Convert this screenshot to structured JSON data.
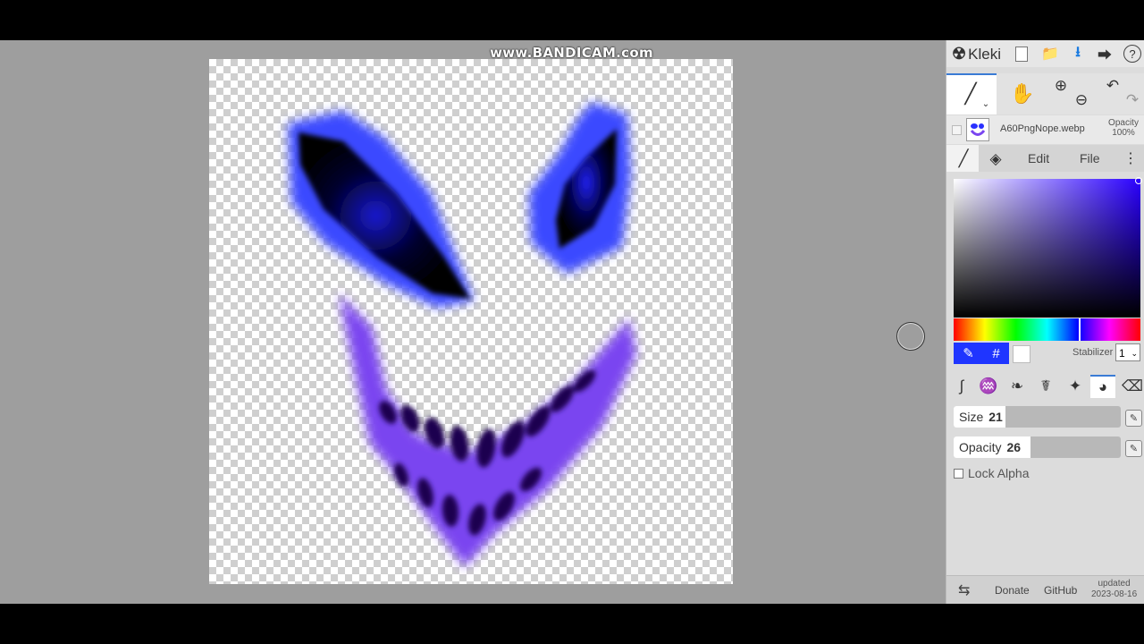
{
  "recording": {
    "watermark": "www.BANDICAM.com"
  },
  "app": {
    "name": "Kleki",
    "header_icons": [
      "new-file-icon",
      "open-folder-icon",
      "download-icon",
      "share-icon",
      "help-icon"
    ],
    "help_glyph": "?"
  },
  "toolbar": {
    "tools": [
      "brush-tool-icon",
      "hand-tool-icon",
      "zoom-in-icon",
      "zoom-out-icon",
      "undo-icon",
      "redo-icon"
    ]
  },
  "layer": {
    "name": "A60PngNope.webp",
    "opacity_label": "Opacity",
    "opacity_value": "100%"
  },
  "tabs": {
    "edit": "Edit",
    "file": "File"
  },
  "color": {
    "primary": "#1f35ff",
    "secondary": "#ffffff",
    "hex_glyph": "#",
    "stabilizer_label": "Stabilizer",
    "stabilizer_value": "1"
  },
  "brush_types": [
    "pen-brush-icon",
    "blend-brush-icon",
    "sketchy-brush-icon",
    "pixel-brush-icon",
    "chemy-brush-icon",
    "smooth-brush-icon",
    "eraser-icon"
  ],
  "brush": {
    "size_label": "Size",
    "size_value": "21",
    "size_fraction": 0.06,
    "opacity_label": "Opacity",
    "opacity_value": "26",
    "opacity_fraction": 0.26,
    "lock_alpha_label": "Lock Alpha"
  },
  "footer": {
    "donate": "Donate",
    "github": "GitHub",
    "updated_label": "updated",
    "updated_date": "2023-08-16"
  }
}
